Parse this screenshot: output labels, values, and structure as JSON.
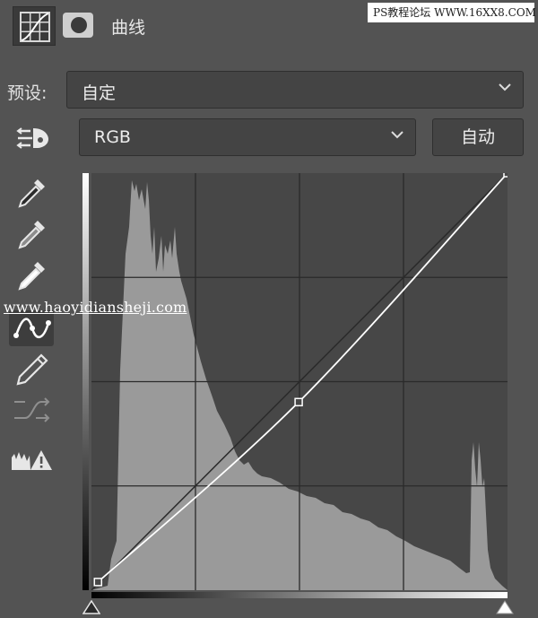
{
  "header": {
    "panel_icon": "curves-adjustment-icon",
    "mask_icon": "layer-mask-icon",
    "title": "曲线",
    "watermark": "PS教程论坛 WWW.16XX8.COM"
  },
  "preset": {
    "label": "预设:",
    "value": "自定"
  },
  "channel": {
    "value": "RGB",
    "auto_label": "自动"
  },
  "tools": [
    {
      "name": "on-image-adjust-icon",
      "active": false
    },
    {
      "name": "black-point-eyedropper-icon",
      "active": false
    },
    {
      "name": "gray-point-eyedropper-icon",
      "active": false
    },
    {
      "name": "white-point-eyedropper-icon",
      "active": false
    },
    {
      "name": "edit-points-curve-icon",
      "active": true
    },
    {
      "name": "pencil-draw-icon",
      "active": false
    },
    {
      "name": "smooth-curve-icon",
      "active": false
    },
    {
      "name": "clipping-warning-icon",
      "active": false
    }
  ],
  "graph_watermark": "www.haoyidiansheji.com",
  "colors": {
    "panel_bg": "#535353",
    "graph_bg": "#474747",
    "histogram": "#9a9a9a",
    "curve": "#ffffff"
  },
  "chart_data": {
    "type": "line",
    "xlim": [
      0,
      255
    ],
    "ylim": [
      0,
      255
    ],
    "grid": true,
    "grid_divisions": 4,
    "curve_points": [
      [
        4,
        5
      ],
      [
        127,
        115
      ],
      [
        255,
        255
      ]
    ],
    "baseline": [
      [
        0,
        0
      ],
      [
        255,
        255
      ]
    ],
    "histogram_channel": "RGB"
  }
}
